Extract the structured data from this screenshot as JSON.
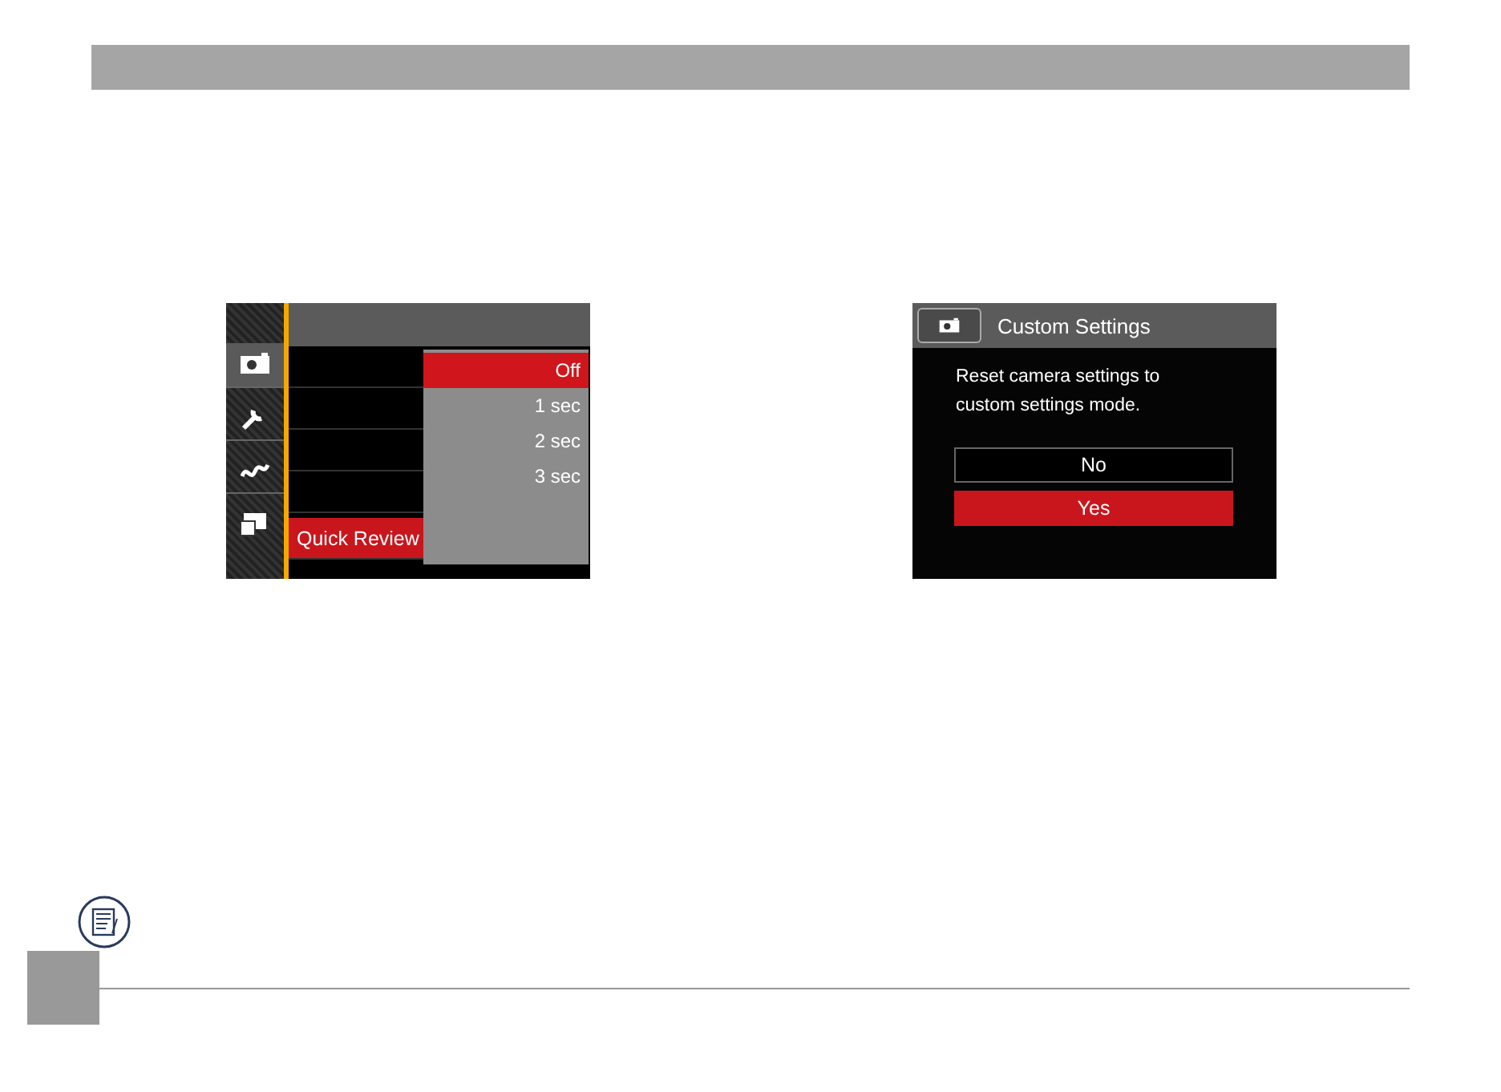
{
  "menu_screen": {
    "sidebar": [
      {
        "kind": "camera",
        "selected": true
      },
      {
        "kind": "wrench",
        "selected": false
      },
      {
        "kind": "wave",
        "selected": false
      },
      {
        "kind": "display",
        "selected": false
      }
    ],
    "menu_rows": [
      {
        "selected": false
      },
      {
        "selected": false
      },
      {
        "selected": false
      },
      {
        "selected": false
      },
      {
        "label": "Quick Review",
        "selected": true
      }
    ],
    "options": [
      {
        "label": "Off",
        "selected": true
      },
      {
        "label": "1 sec",
        "selected": false
      },
      {
        "label": "2 sec",
        "selected": false
      },
      {
        "label": "3 sec",
        "selected": false
      }
    ]
  },
  "dialog_screen": {
    "title": "Custom Settings",
    "message": "Reset camera settings to custom settings mode.",
    "buttons": [
      {
        "label": "No",
        "selected": false
      },
      {
        "label": "Yes",
        "selected": true
      }
    ]
  }
}
